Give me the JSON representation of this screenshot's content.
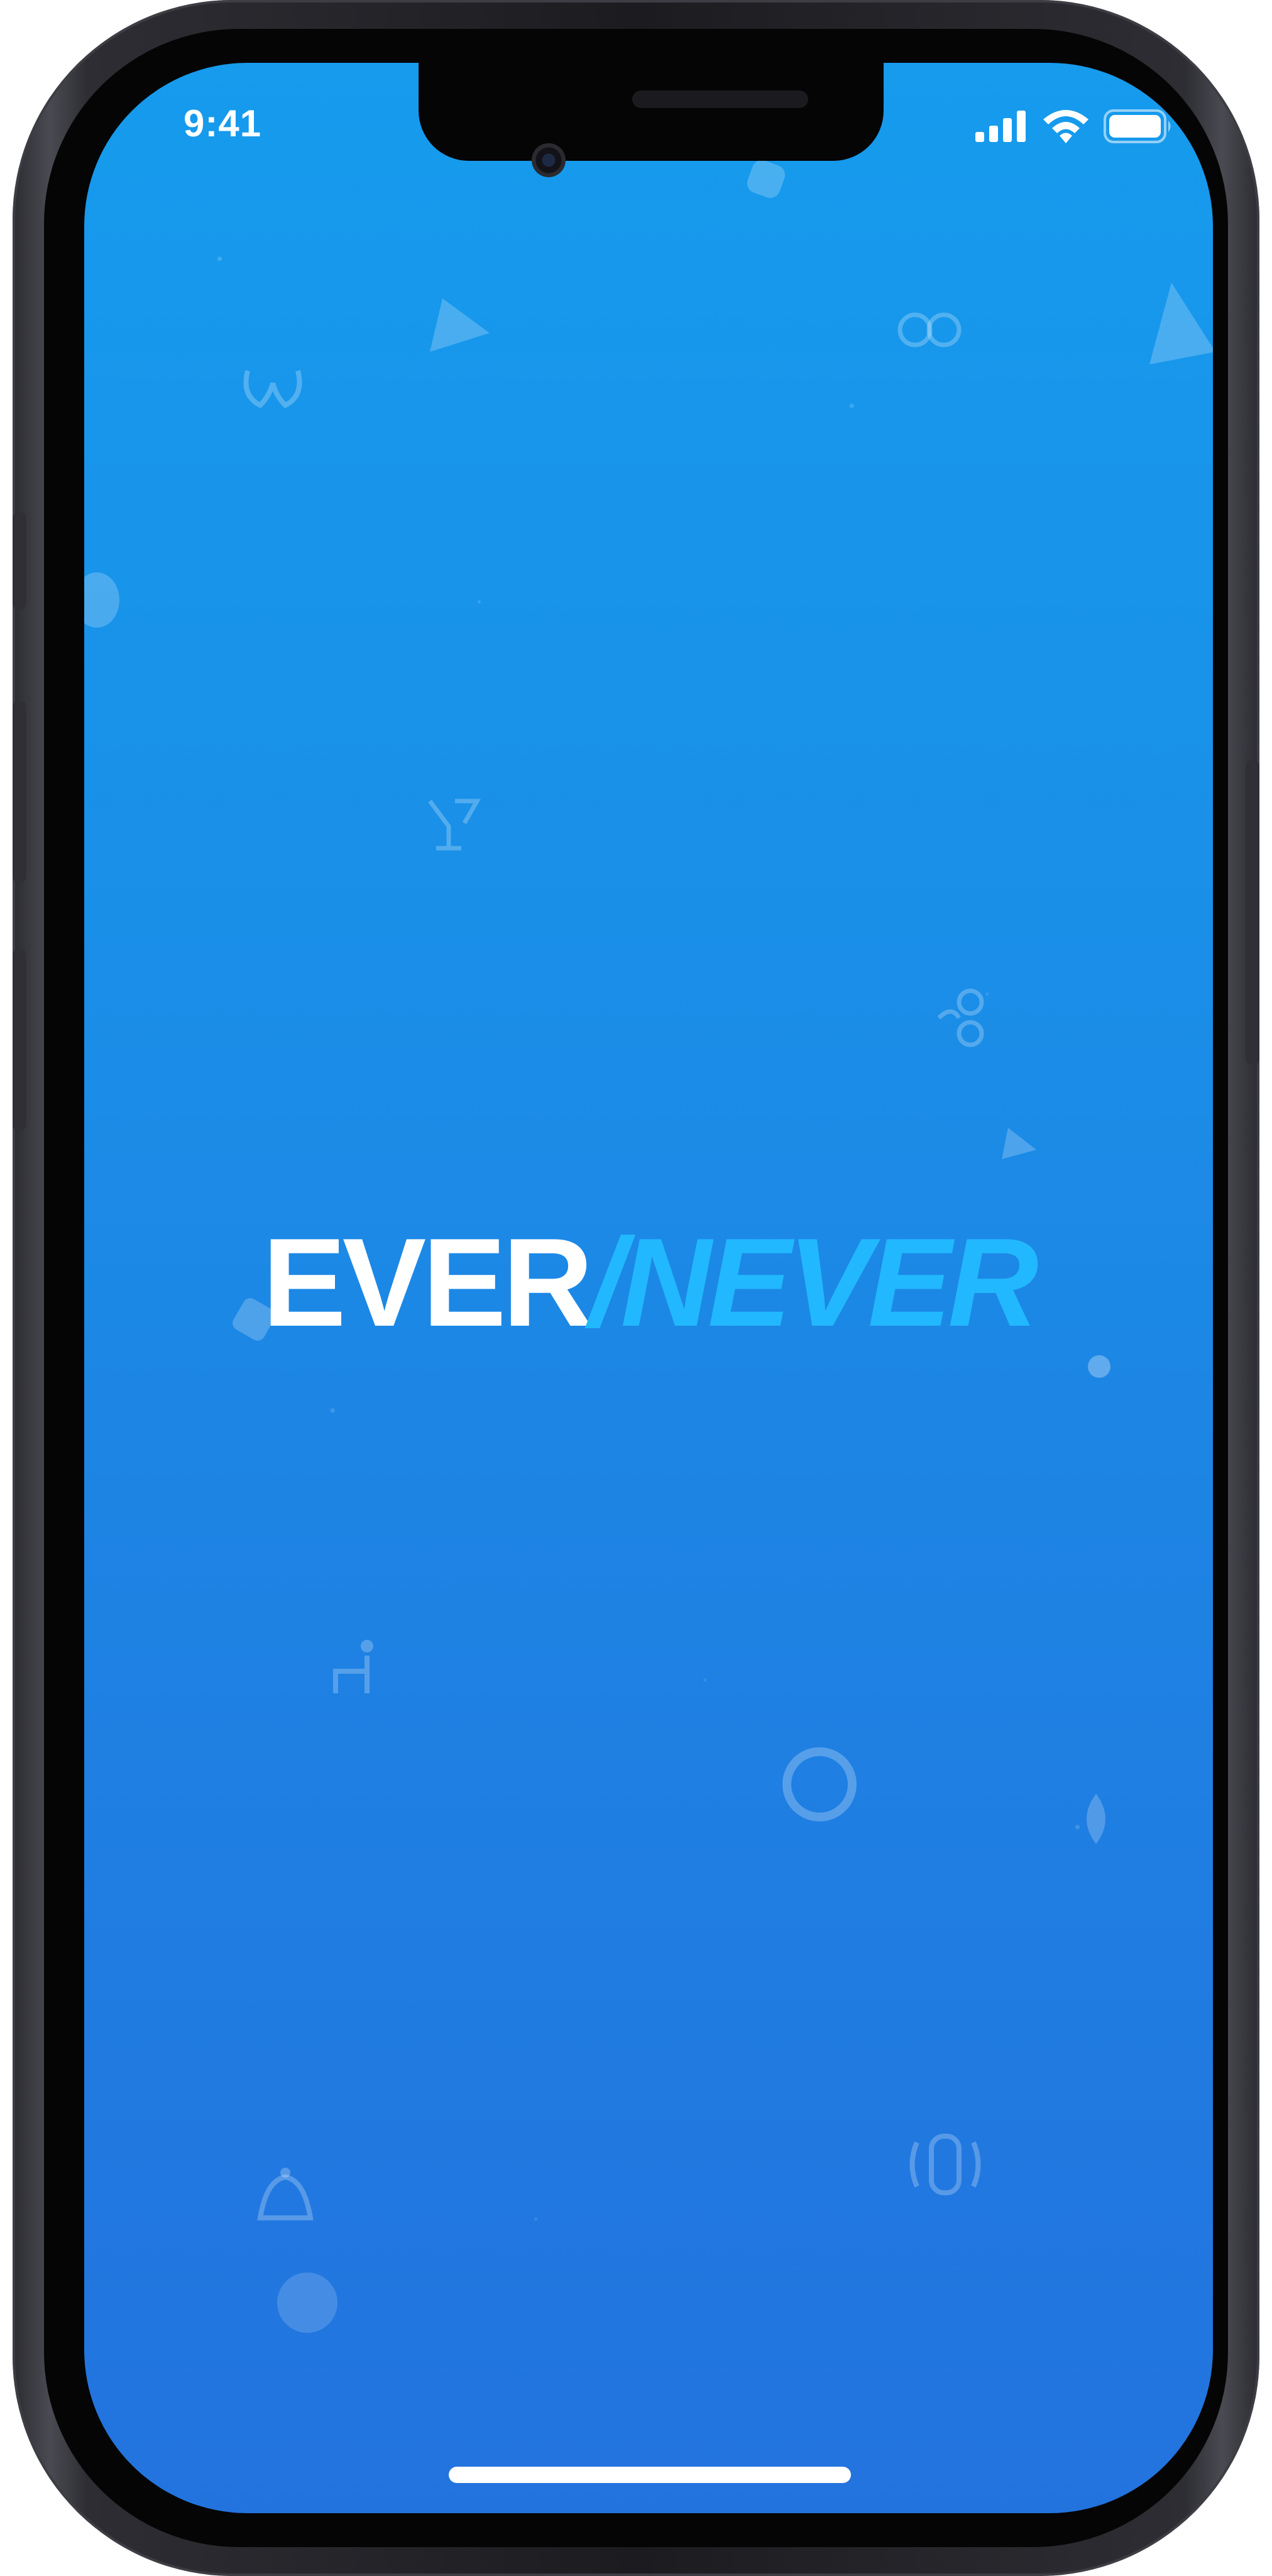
{
  "status_bar": {
    "time": "9:41",
    "icons": [
      "signal-icon",
      "wifi-icon",
      "battery-icon"
    ]
  },
  "logo": {
    "part1": "EVER",
    "part2": "/NEVER"
  },
  "colors": {
    "background_top": "#169bed",
    "background_bottom": "#2373de",
    "logo_primary": "#ffffff",
    "logo_accent": "#22b8ff"
  }
}
